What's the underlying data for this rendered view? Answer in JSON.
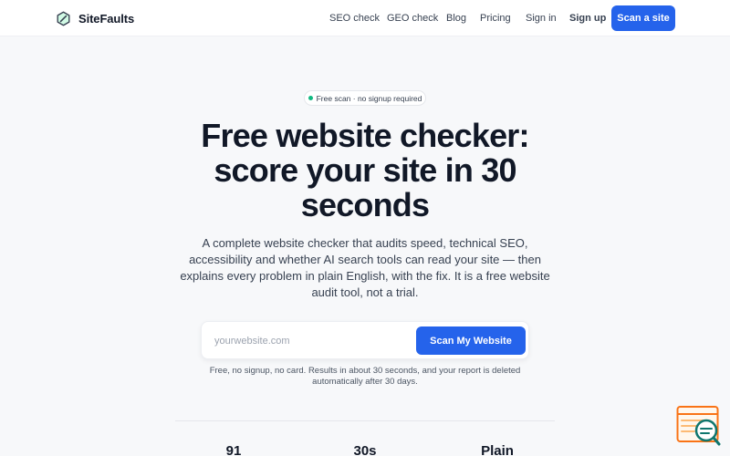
{
  "brand": {
    "name": "SiteFaults",
    "logo_icon": "hexagon-slash-icon"
  },
  "nav": {
    "items": [
      {
        "label": "SEO check"
      },
      {
        "label": "GEO check"
      },
      {
        "label": "Blog"
      },
      {
        "label": "Pricing"
      },
      {
        "label": "Sign in"
      }
    ],
    "signup_label": "Sign up",
    "cta_label": "Scan a site"
  },
  "hero": {
    "badge": "Free scan · no signup required",
    "title": "Free website checker: score your site in 30 seconds",
    "subtitle": "A complete website checker that audits speed, technical SEO, accessibility and whether AI search tools can read your site — then explains every problem in plain English, with the fix. It is a free website audit tool, not a trial.",
    "input_placeholder": "yourwebsite.com",
    "input_value": "",
    "submit_label": "Scan My Website",
    "note": "Free, no signup, no card. Results in about 30 seconds, and your report is deleted automatically after 30 days."
  },
  "stats": [
    {
      "value": "91"
    },
    {
      "value": "30s"
    },
    {
      "value": "Plain"
    }
  ],
  "widget": {
    "icon": "browser-search-icon"
  },
  "colors": {
    "accent": "#2563eb",
    "status_dot": "#10b981",
    "widget_orange": "#f97316",
    "widget_teal": "#0f766e"
  }
}
